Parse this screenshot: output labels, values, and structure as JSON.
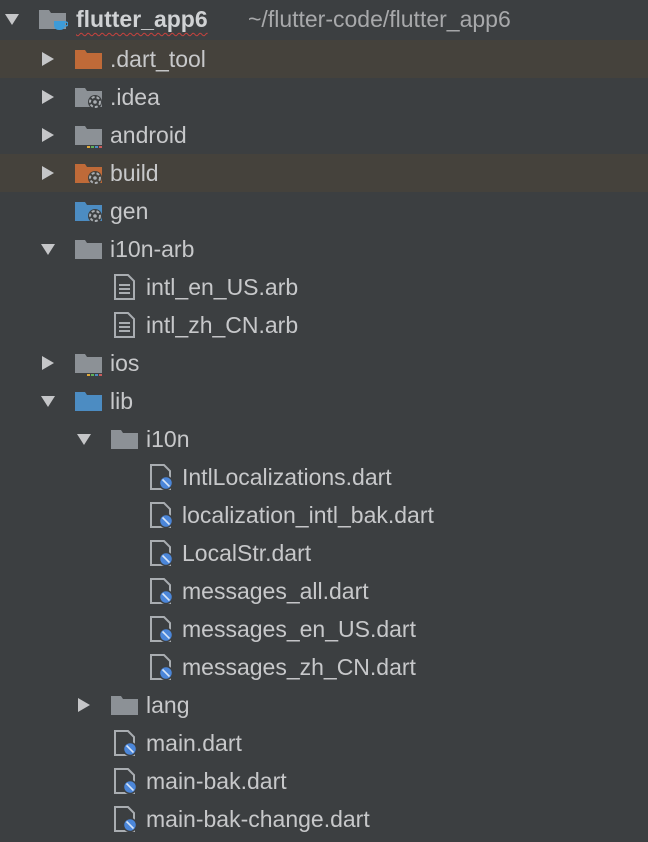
{
  "colors": {
    "background": "#3c3f41",
    "highlight_row": "#45423c",
    "text": "#c7c8ca",
    "text_muted": "#a8a9ab",
    "folder_gray": "#8c9196",
    "folder_excluded": "#bf6a38",
    "folder_source": "#4c8cc2",
    "dart_badge": "#4b86d9",
    "wavy_underline": "#c9423e"
  },
  "tree": {
    "root": {
      "name": "flutter_app6",
      "path": "~/flutter-code/flutter_app6",
      "icon": "module-folder-icon"
    },
    "rows": [
      {
        "label": "flutter_app6",
        "arrow": "expanded",
        "icon": "module-folder",
        "highlight": false
      },
      {
        "label": ".dart_tool",
        "arrow": "collapsed",
        "icon": "excluded-folder",
        "highlight": true
      },
      {
        "label": ".idea",
        "arrow": "collapsed",
        "icon": "idea-folder",
        "highlight": false
      },
      {
        "label": "android",
        "arrow": "collapsed",
        "icon": "android-folder",
        "highlight": false
      },
      {
        "label": "build",
        "arrow": "collapsed",
        "icon": "excluded-gear-folder",
        "highlight": true
      },
      {
        "label": "gen",
        "arrow": "none",
        "icon": "generated-folder",
        "highlight": false
      },
      {
        "label": "i10n-arb",
        "arrow": "expanded",
        "icon": "folder",
        "highlight": false
      },
      {
        "label": "intl_en_US.arb",
        "arrow": "none",
        "icon": "text-file",
        "highlight": false
      },
      {
        "label": "intl_zh_CN.arb",
        "arrow": "none",
        "icon": "text-file",
        "highlight": false
      },
      {
        "label": "ios",
        "arrow": "collapsed",
        "icon": "ios-folder",
        "highlight": false
      },
      {
        "label": "lib",
        "arrow": "expanded",
        "icon": "source-folder",
        "highlight": false
      },
      {
        "label": "i10n",
        "arrow": "expanded",
        "icon": "folder",
        "highlight": false
      },
      {
        "label": "IntlLocalizations.dart",
        "arrow": "none",
        "icon": "dart-file",
        "highlight": false
      },
      {
        "label": "localization_intl_bak.dart",
        "arrow": "none",
        "icon": "dart-file",
        "highlight": false
      },
      {
        "label": "LocalStr.dart",
        "arrow": "none",
        "icon": "dart-file",
        "highlight": false
      },
      {
        "label": "messages_all.dart",
        "arrow": "none",
        "icon": "dart-file",
        "highlight": false
      },
      {
        "label": "messages_en_US.dart",
        "arrow": "none",
        "icon": "dart-file",
        "highlight": false
      },
      {
        "label": "messages_zh_CN.dart",
        "arrow": "none",
        "icon": "dart-file",
        "highlight": false
      },
      {
        "label": "lang",
        "arrow": "collapsed",
        "icon": "folder",
        "highlight": false
      },
      {
        "label": "main.dart",
        "arrow": "none",
        "icon": "dart-file",
        "highlight": false
      },
      {
        "label": "main-bak.dart",
        "arrow": "none",
        "icon": "dart-file",
        "highlight": false
      },
      {
        "label": "main-bak-change.dart",
        "arrow": "none",
        "icon": "dart-file",
        "highlight": false
      }
    ]
  }
}
